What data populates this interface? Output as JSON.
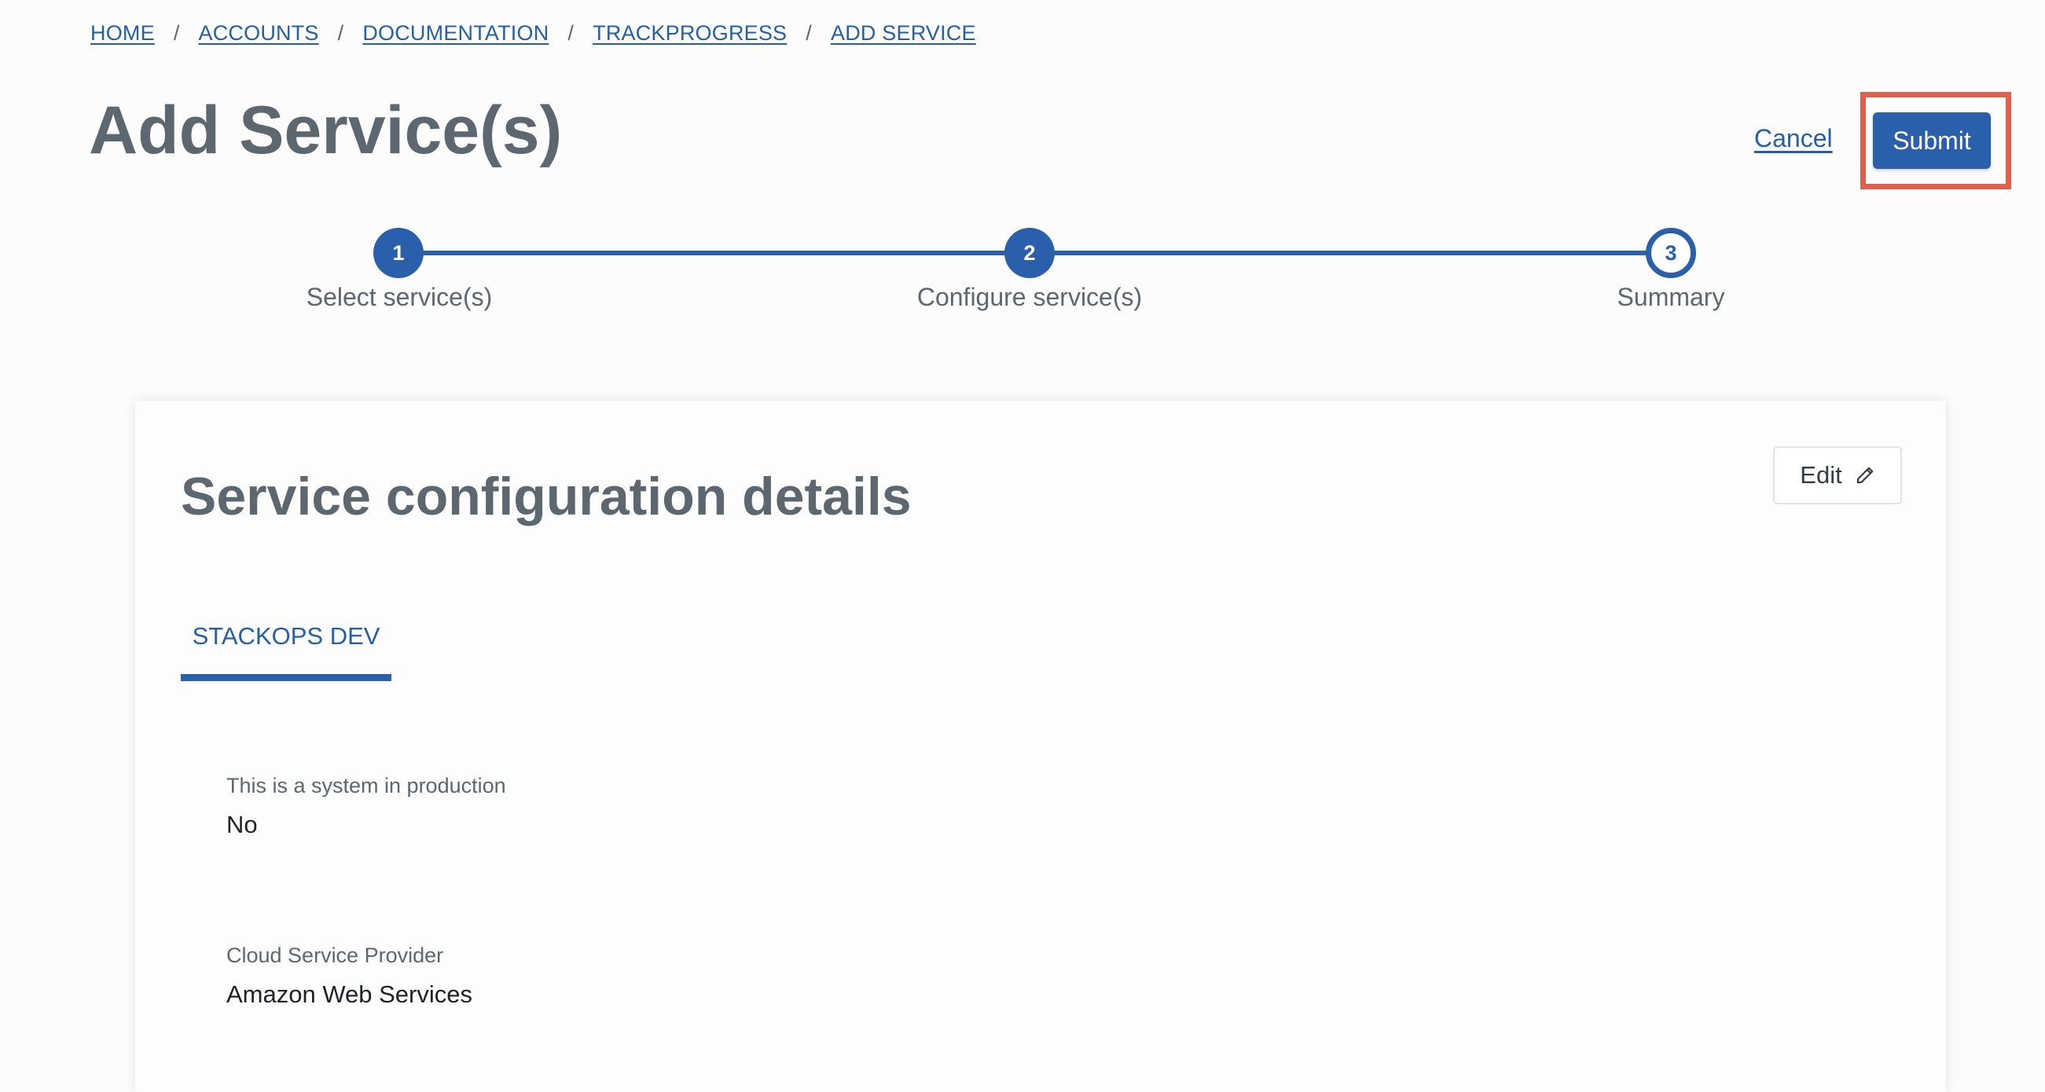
{
  "breadcrumb": {
    "items": [
      "HOME",
      "ACCOUNTS",
      "DOCUMENTATION",
      "TRACKPROGRESS",
      "ADD SERVICE"
    ],
    "separator": "/"
  },
  "header": {
    "title": "Add Service(s)",
    "cancel_label": "Cancel",
    "submit_label": "Submit"
  },
  "stepper": {
    "steps": [
      {
        "number": "1",
        "label": "Select service(s)",
        "status": "complete"
      },
      {
        "number": "2",
        "label": "Configure service(s)",
        "status": "complete"
      },
      {
        "number": "3",
        "label": "Summary",
        "status": "current"
      }
    ]
  },
  "card": {
    "title": "Service configuration details",
    "edit_label": "Edit",
    "edit_icon": "pencil-icon",
    "tab_label": "STACKOPS DEV",
    "fields": [
      {
        "label": "This is a system in production",
        "value": "No"
      },
      {
        "label": "Cloud Service Provider",
        "value": "Amazon Web Services"
      }
    ]
  },
  "colors": {
    "accent": "#2a5fab",
    "link": "#245fa8",
    "text_muted": "#5d6770",
    "highlight": "#e2604b"
  }
}
